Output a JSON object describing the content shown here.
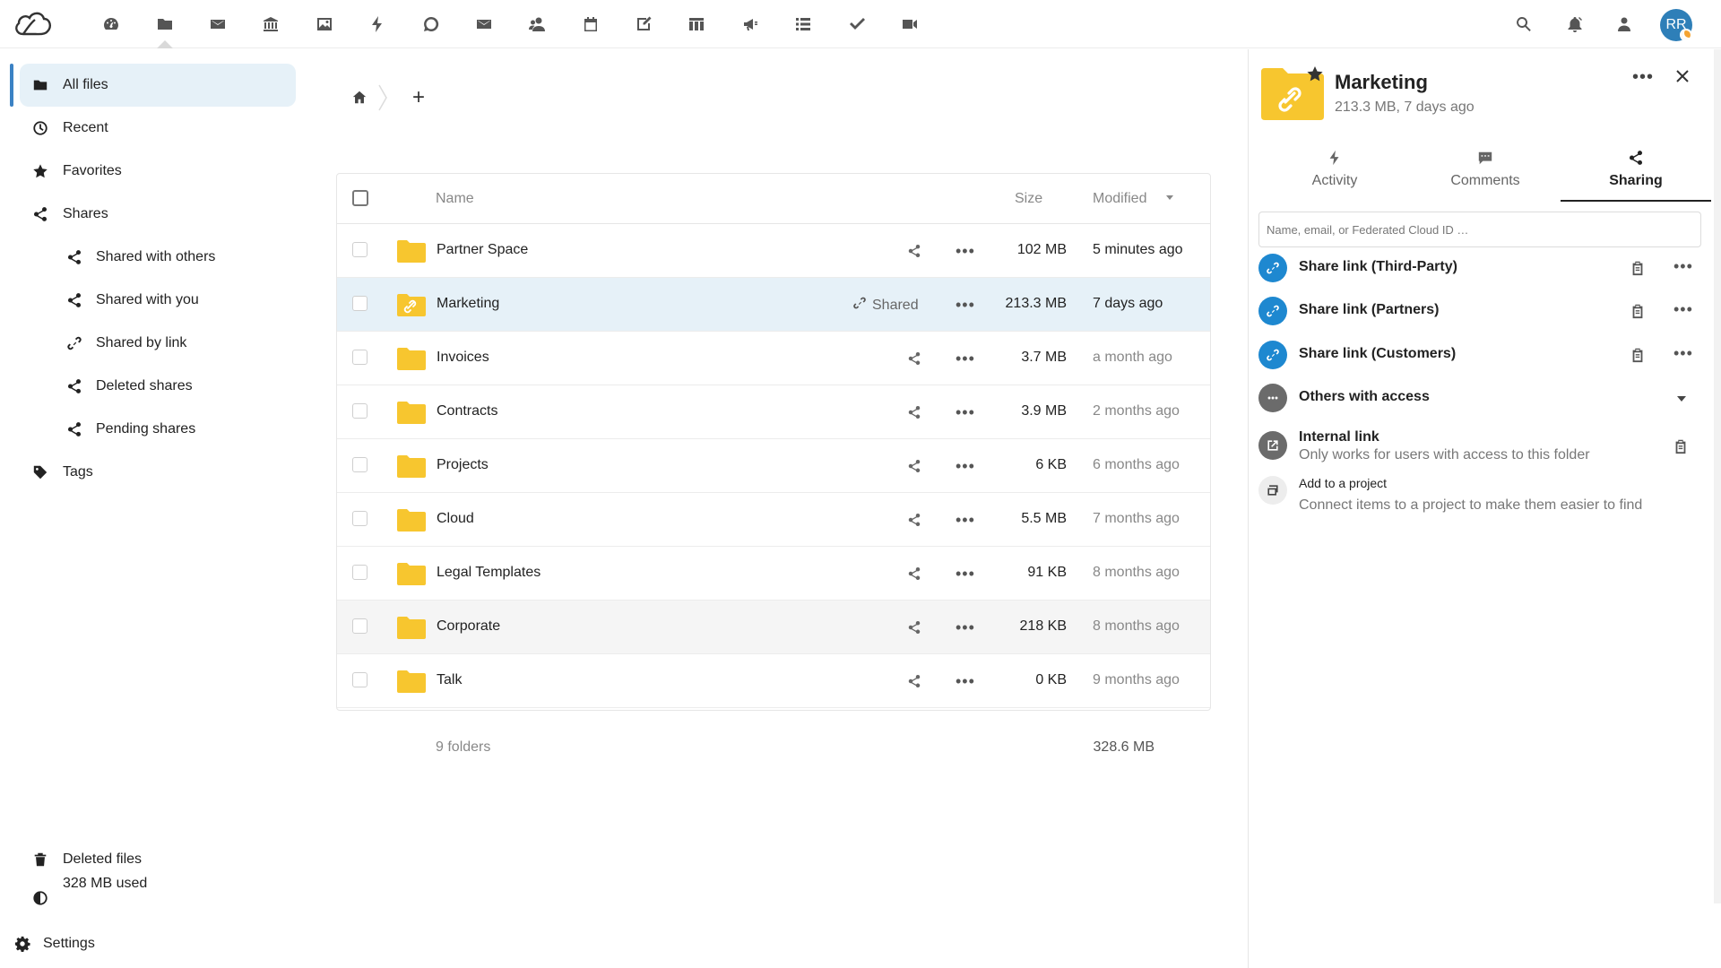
{
  "header": {
    "apps": [
      {
        "name": "dashboard",
        "icon": "dashboard-icon"
      },
      {
        "name": "files",
        "icon": "folder-icon",
        "active": true
      },
      {
        "name": "mail",
        "icon": "mail-icon"
      },
      {
        "name": "bank",
        "icon": "bank-icon"
      },
      {
        "name": "photos",
        "icon": "image-icon"
      },
      {
        "name": "activity",
        "icon": "lightning-icon"
      },
      {
        "name": "talk",
        "icon": "chat-bubble-icon"
      },
      {
        "name": "mail-2",
        "icon": "mail-icon"
      },
      {
        "name": "contacts",
        "icon": "contacts-icon"
      },
      {
        "name": "calendar",
        "icon": "calendar-icon"
      },
      {
        "name": "notes",
        "icon": "notes-icon"
      },
      {
        "name": "deck",
        "icon": "deck-icon"
      },
      {
        "name": "announcements",
        "icon": "megaphone-icon"
      },
      {
        "name": "tasks-list",
        "icon": "list-icon"
      },
      {
        "name": "tasks",
        "icon": "checkmark-icon"
      },
      {
        "name": "video",
        "icon": "video-icon"
      }
    ],
    "avatar_initials": "RR"
  },
  "nav": {
    "items": [
      {
        "label": "All files",
        "icon": "folder-icon"
      },
      {
        "label": "Recent",
        "icon": "clock-icon"
      },
      {
        "label": "Favorites",
        "icon": "star-icon"
      },
      {
        "label": "Shares",
        "icon": "share-icon"
      },
      {
        "label": "Shared with others",
        "icon": "share-icon"
      },
      {
        "label": "Shared with you",
        "icon": "share-icon"
      },
      {
        "label": "Shared by link",
        "icon": "link-icon"
      },
      {
        "label": "Deleted shares",
        "icon": "share-icon"
      },
      {
        "label": "Pending shares",
        "icon": "share-icon"
      },
      {
        "label": "Tags",
        "icon": "tag-icon"
      }
    ],
    "deleted_files": "Deleted files",
    "storage_used": "328 MB used",
    "settings": "Settings"
  },
  "files": {
    "columns": {
      "name": "Name",
      "size": "Size",
      "modified": "Modified"
    },
    "rows": [
      {
        "name": "Partner Space",
        "size": "102 MB",
        "modified": "5 minutes ago"
      },
      {
        "name": "Marketing",
        "size": "213.3 MB",
        "modified": "7 days ago",
        "shared_label": "Shared"
      },
      {
        "name": "Invoices",
        "size": "3.7 MB",
        "modified": "a month ago"
      },
      {
        "name": "Contracts",
        "size": "3.9 MB",
        "modified": "2 months ago"
      },
      {
        "name": "Projects",
        "size": "6 KB",
        "modified": "6 months ago"
      },
      {
        "name": "Cloud",
        "size": "5.5 MB",
        "modified": "7 months ago"
      },
      {
        "name": "Legal Templates",
        "size": "91 KB",
        "modified": "8 months ago"
      },
      {
        "name": "Corporate",
        "size": "218 KB",
        "modified": "8 months ago"
      },
      {
        "name": "Talk",
        "size": "0 KB",
        "modified": "9 months ago"
      }
    ],
    "footer_count": "9 folders",
    "footer_size": "328.6 MB"
  },
  "sidebar": {
    "title": "Marketing",
    "subtitle": "213.3 MB, 7 days ago",
    "tabs": [
      {
        "label": "Activity",
        "icon": "lightning-icon"
      },
      {
        "label": "Comments",
        "icon": "comment-icon"
      },
      {
        "label": "Sharing",
        "icon": "share-icon"
      }
    ],
    "search_placeholder": "Name, email, or Federated Cloud ID …",
    "share_links": [
      "Share link (Third-Party)",
      "Share link (Partners)",
      "Share link (Customers)"
    ],
    "others_with_access": "Others with access",
    "internal_link_title": "Internal link",
    "internal_link_desc": "Only works for users with access to this folder",
    "project_title": "Add to a project",
    "project_desc": "Connect items to a project to make them easier to find"
  },
  "colors": {
    "accent": "#1e88d0",
    "folder": "#f7c62f",
    "selected_row": "#e6f1f8"
  }
}
